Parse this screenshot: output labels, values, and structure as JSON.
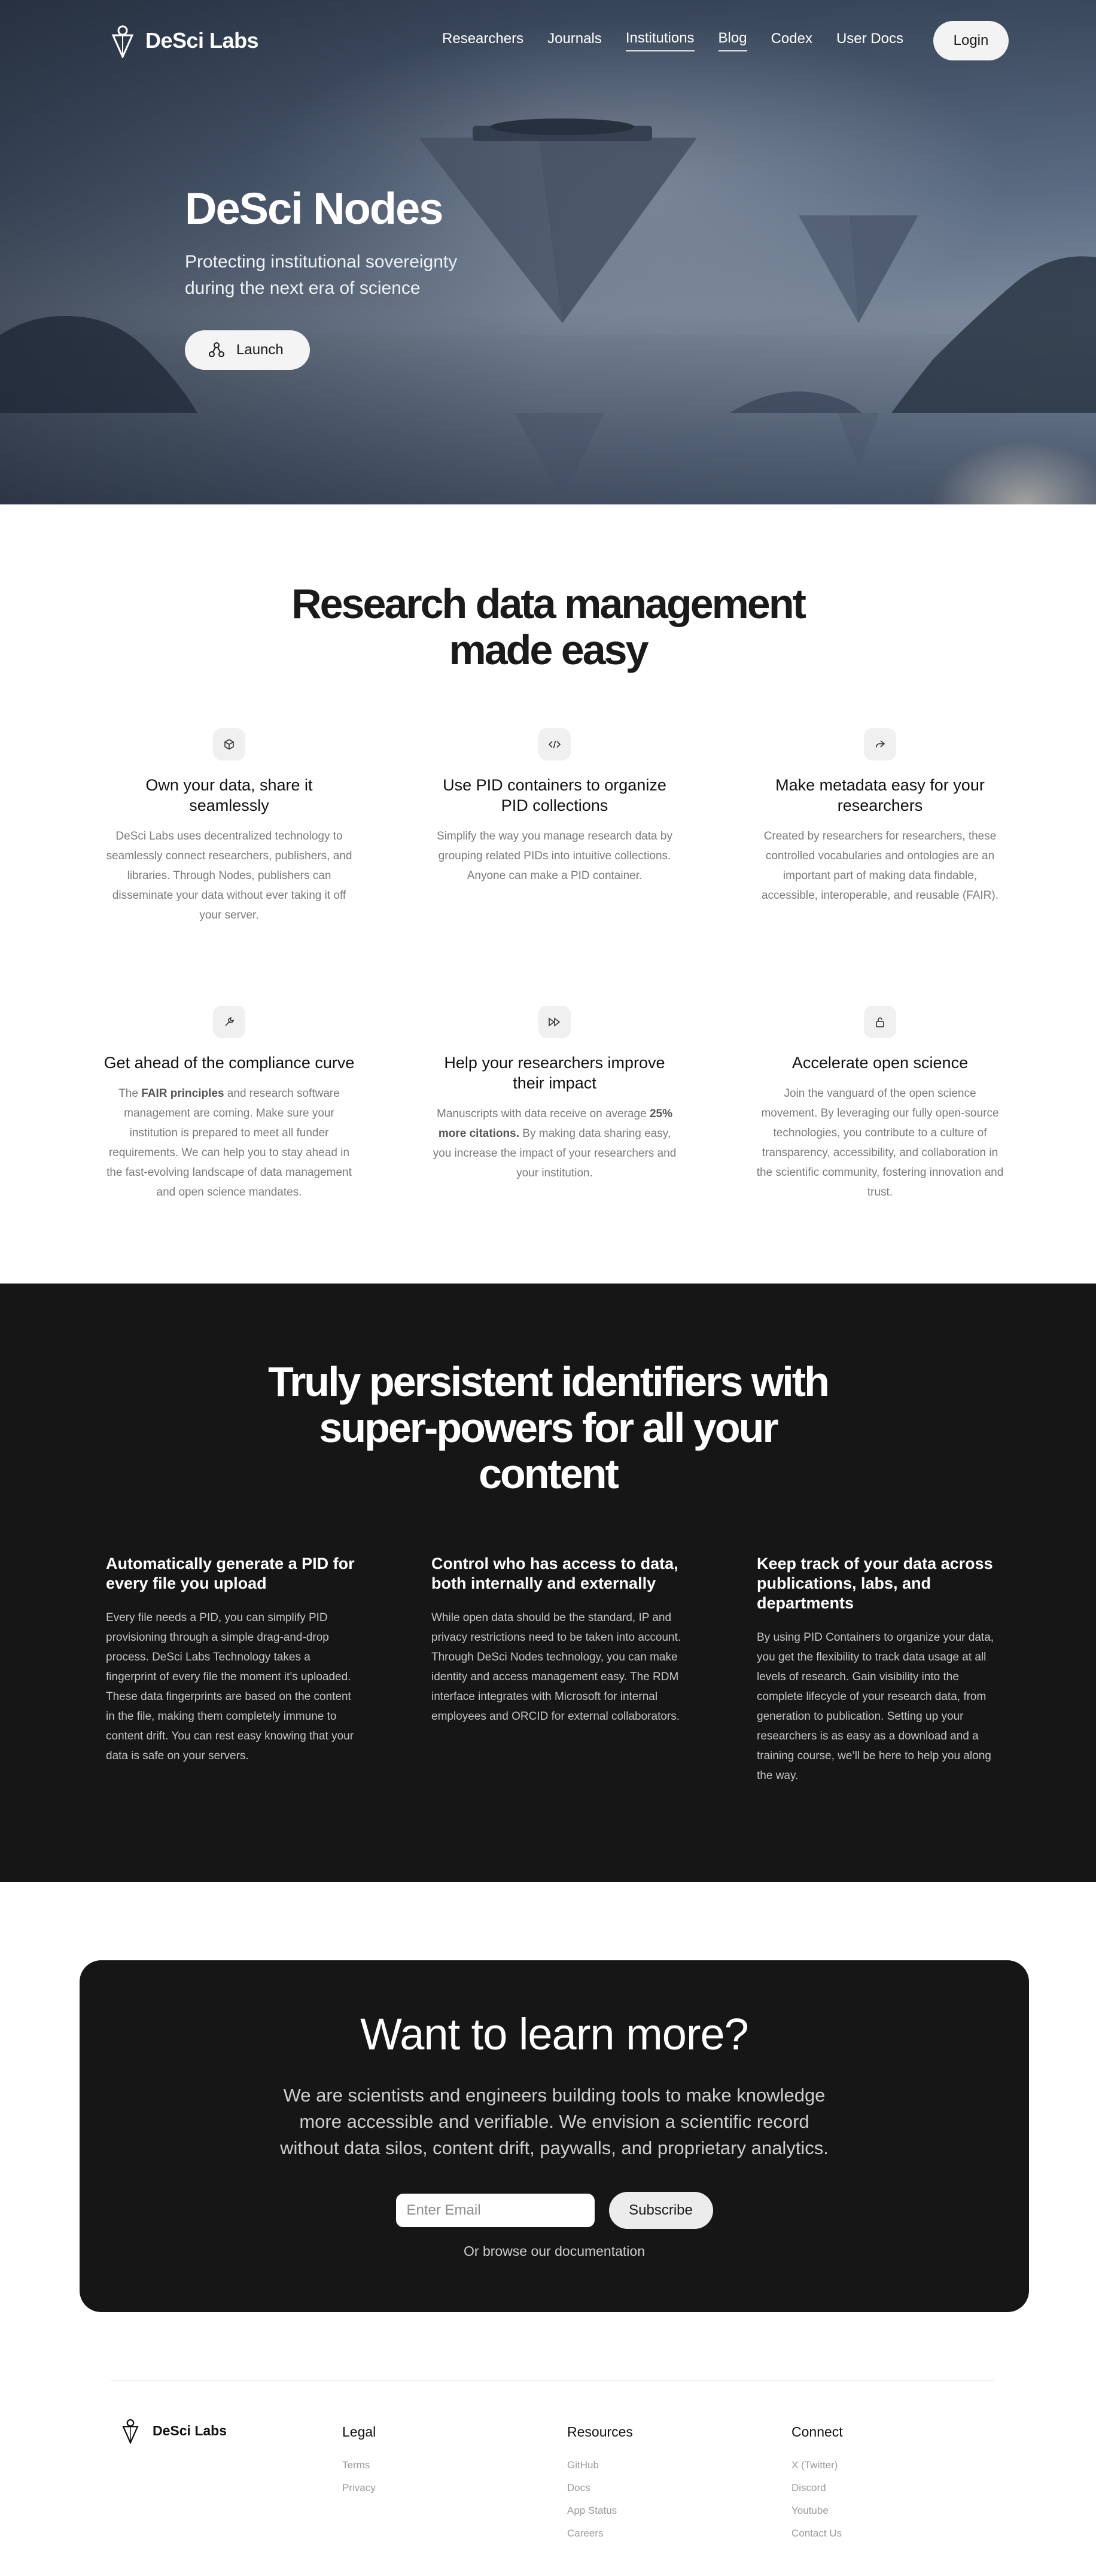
{
  "nav": {
    "brand": "DeSci Labs",
    "links": [
      "Researchers",
      "Journals",
      "Institutions",
      "Blog",
      "Codex",
      "User Docs"
    ],
    "login": "Login"
  },
  "hero": {
    "title": "DeSci Nodes",
    "subtitle": "Protecting institutional sovereignty during the next era of science",
    "launch": "Launch"
  },
  "features": {
    "title": "Research data management made easy",
    "items": [
      {
        "icon": "cube-icon",
        "title": "Own your data, share it seamlessly",
        "text": "DeSci Labs uses decentralized technology to seamlessly connect researchers, publishers, and libraries. Through Nodes, publishers can disseminate your data without ever taking it off your server."
      },
      {
        "icon": "code-icon",
        "title": "Use PID containers to organize PID collections",
        "text": "Simplify the way you manage research data by grouping related PIDs into intuitive collections. Anyone can make a PID container."
      },
      {
        "icon": "share-arrow-icon",
        "title": "Make metadata easy for your researchers",
        "text": "Created by researchers for researchers, these controlled vocabularies and ontologies are an important part of making data findable, accessible, interoperable, and reusable (FAIR)."
      },
      {
        "icon": "wrench-icon",
        "title": "Get ahead of the compliance curve",
        "text_pre": "The ",
        "text_bold": "FAIR principles",
        "text_post": " and research software management are coming. Make sure your institution is prepared to meet all funder requirements. We can help you to stay ahead in the fast-evolving landscape of data management and open science mandates."
      },
      {
        "icon": "fast-forward-icon",
        "title": "Help your researchers improve their impact",
        "text_pre": "Manuscripts with data receive on average ",
        "text_bold": "25% more citations.",
        "text_post": " By making data sharing easy, you increase the impact of your researchers and your institution."
      },
      {
        "icon": "unlock-icon",
        "title": "Accelerate open science",
        "text": "Join the vanguard of the open science movement. By leveraging our fully open-source technologies, you contribute to a culture of transparency, accessibility, and collaboration in the scientific community, fostering innovation and trust."
      }
    ]
  },
  "pid": {
    "title": "Truly persistent identifiers with super-powers for all your content",
    "columns": [
      {
        "title": "Automatically generate a PID for every file you upload",
        "text": "Every file needs a PID, you can simplify PID provisioning through a simple drag-and-drop process. DeSci Labs Technology takes a fingerprint of every file the moment it’s uploaded. These data fingerprints are based on the content in the file, making them completely immune to content drift. You can rest easy knowing that your data is safe on your servers."
      },
      {
        "title": "Control who has access to data, both internally and externally",
        "text": "While open data should be the standard, IP and privacy restrictions need to be taken into account. Through DeSci Nodes technology, you can make identity and access management easy. The RDM interface integrates with Microsoft for internal employees and ORCID for external collaborators."
      },
      {
        "title": "Keep track of your data across publications, labs, and departments",
        "text": "By using PID Containers to organize your data, you get the flexibility to track data usage at all levels of research. Gain visibility into the complete lifecycle of your research data, from generation to publication. Setting up your researchers is as easy as a download and a training course, we’ll be here to help you along the way."
      }
    ]
  },
  "cta": {
    "title": "Want to learn more?",
    "lead": "We are scientists and engineers building tools to make knowledge more accessible and verifiable. We envision a scientific record without data silos, content drift, paywalls, and proprietary analytics.",
    "email_placeholder": "Enter Email",
    "subscribe": "Subscribe",
    "browse": "Or browse our documentation"
  },
  "footer": {
    "brand": "DeSci Labs",
    "columns": [
      {
        "title": "Legal",
        "links": [
          "Terms",
          "Privacy"
        ]
      },
      {
        "title": "Resources",
        "links": [
          "GitHub",
          "Docs",
          "App Status",
          "Careers"
        ]
      },
      {
        "title": "Connect",
        "links": [
          "X (Twitter)",
          "Discord",
          "Youtube",
          "Contact Us"
        ]
      }
    ]
  }
}
